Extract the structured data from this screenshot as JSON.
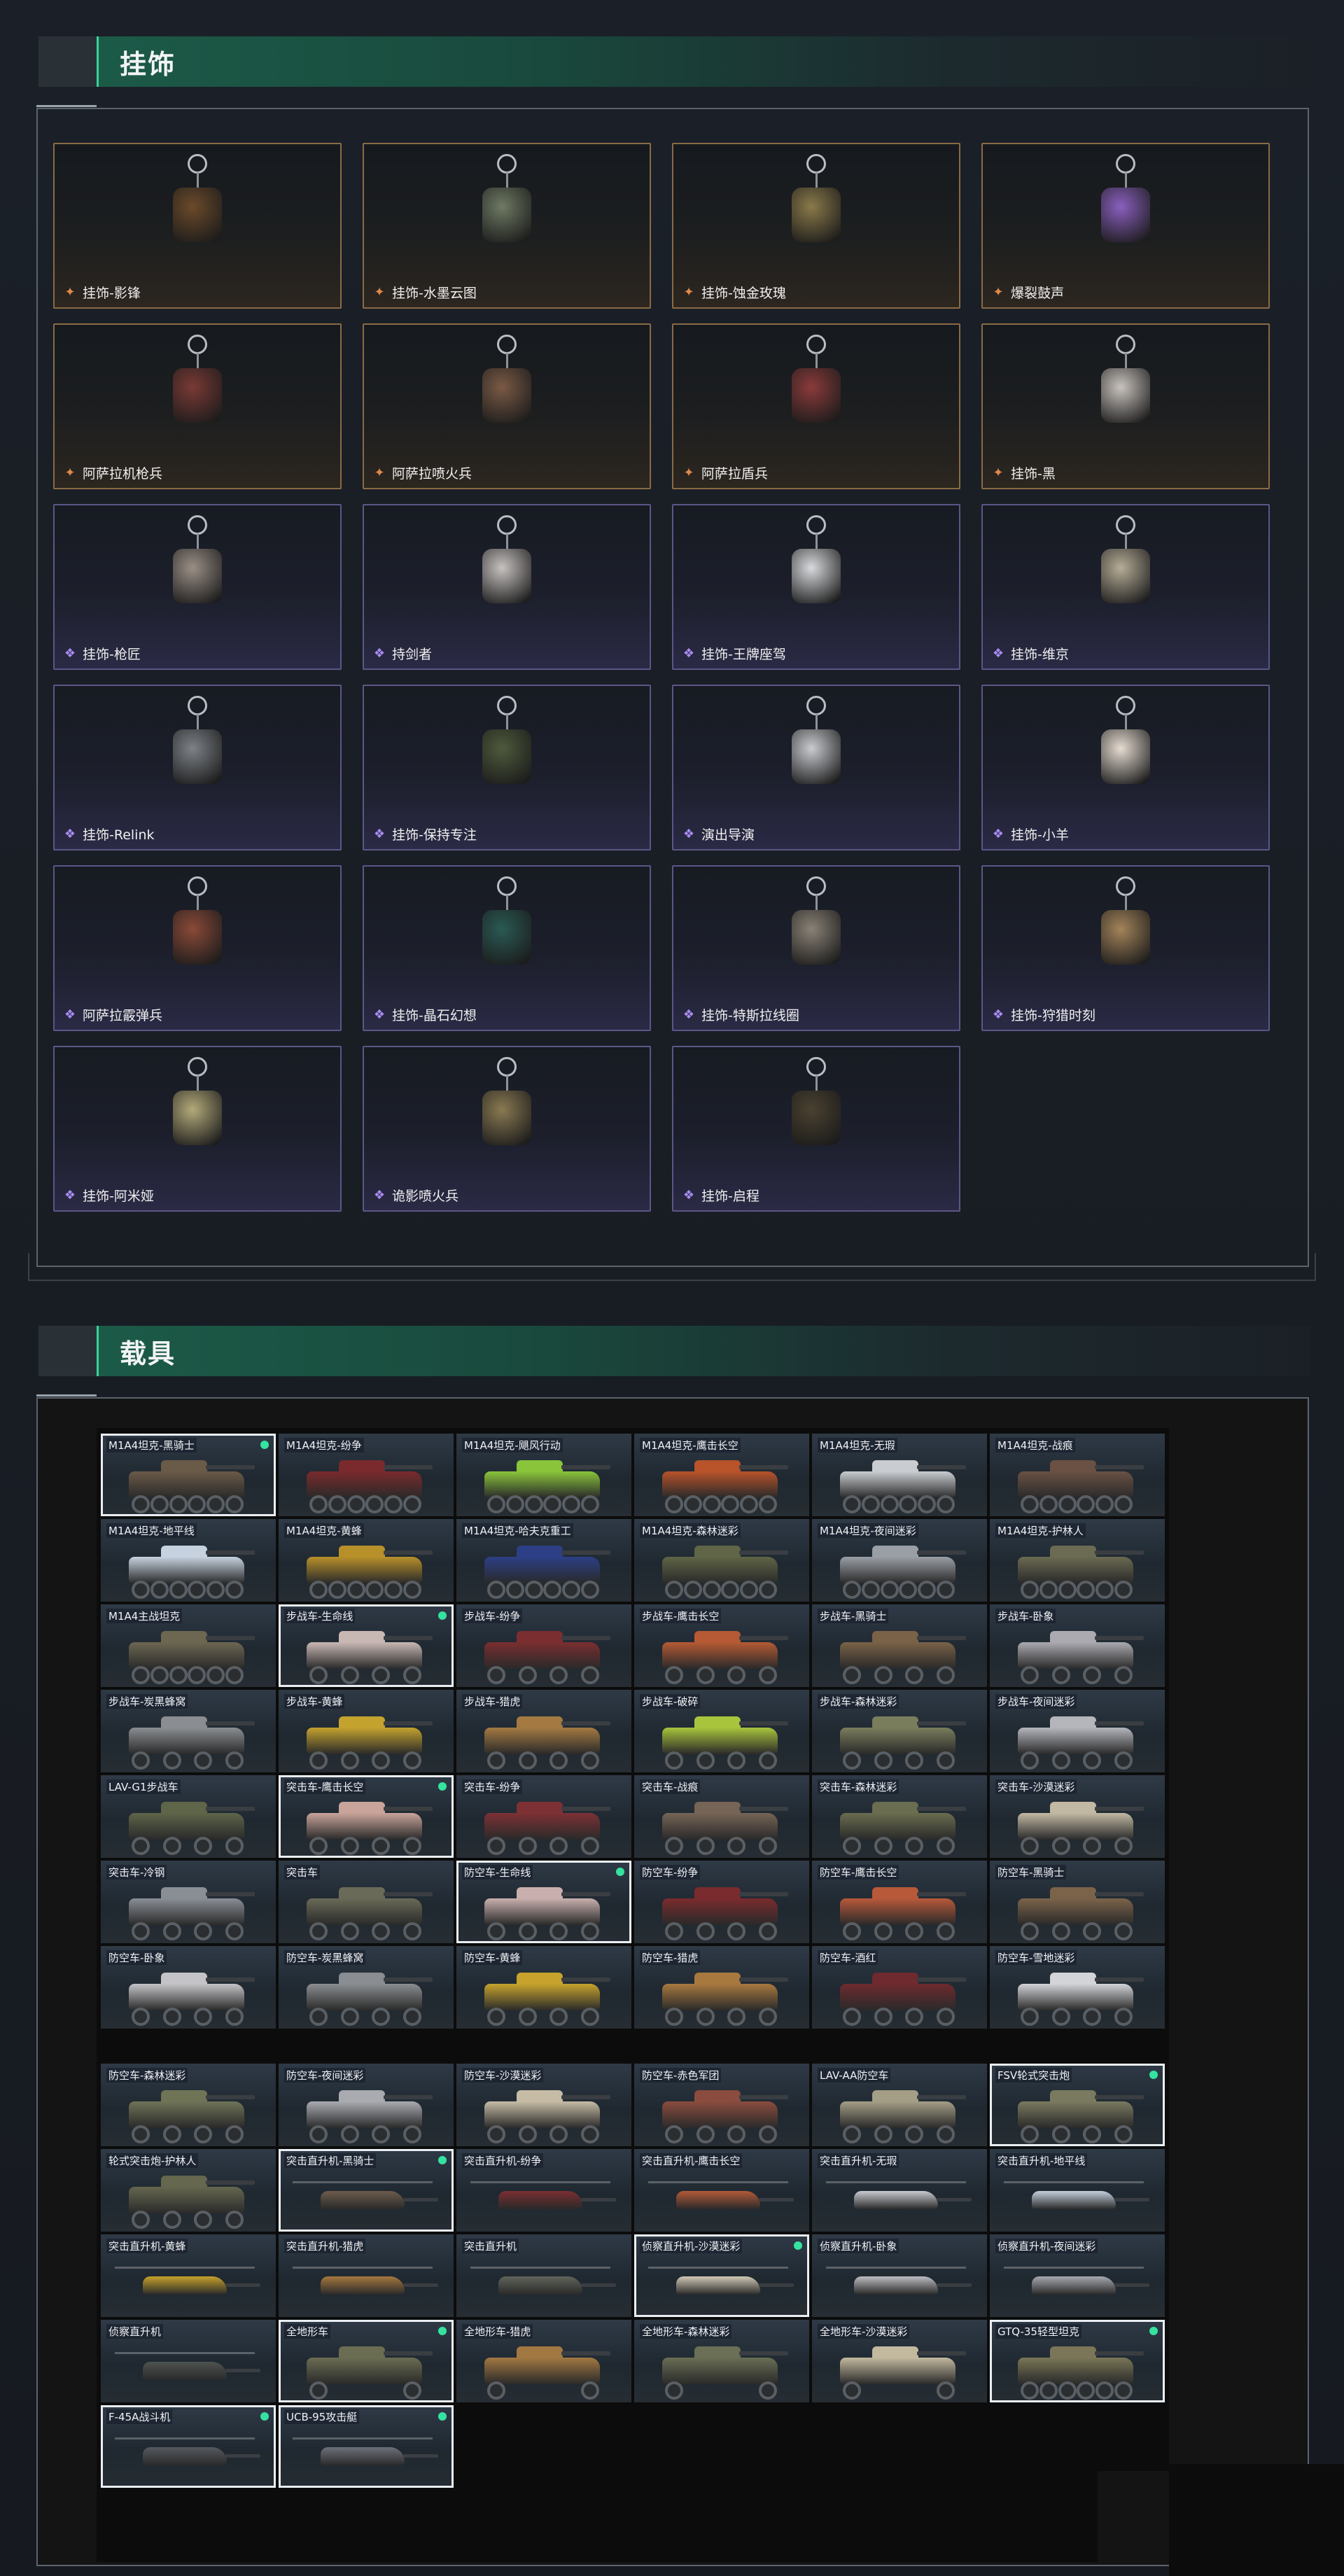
{
  "sections": {
    "charms": {
      "title": "挂饰"
    },
    "vehicles": {
      "title": "载具"
    }
  },
  "charms": [
    {
      "name": "挂饰-影锋",
      "quality": "gold",
      "color": "#6b4a2a"
    },
    {
      "name": "挂饰-水墨云图",
      "quality": "gold",
      "color": "#6e7a63"
    },
    {
      "name": "挂饰-蚀金玫瑰",
      "quality": "gold",
      "color": "#8a7a4a"
    },
    {
      "name": "爆裂鼓声",
      "quality": "gold",
      "color": "#8a5fbf"
    },
    {
      "name": "阿萨拉机枪兵",
      "quality": "gold",
      "color": "#7a3a35"
    },
    {
      "name": "阿萨拉喷火兵",
      "quality": "gold",
      "color": "#7a5a45"
    },
    {
      "name": "阿萨拉盾兵",
      "quality": "gold",
      "color": "#8a3a3a"
    },
    {
      "name": "挂饰-黑",
      "quality": "gold",
      "color": "#c9c3bd"
    },
    {
      "name": "挂饰-枪匠",
      "quality": "purple",
      "color": "#9a8f86"
    },
    {
      "name": "持剑者",
      "quality": "purple",
      "color": "#c7c2c0"
    },
    {
      "name": "挂饰-王牌座驾",
      "quality": "purple",
      "color": "#d8dadd"
    },
    {
      "name": "挂饰-维京",
      "quality": "purple",
      "color": "#b6ad97"
    },
    {
      "name": "挂饰-Relink",
      "quality": "purple",
      "color": "#7d8288"
    },
    {
      "name": "挂饰-保持专注",
      "quality": "purple",
      "color": "#4e5a3c"
    },
    {
      "name": "演出导演",
      "quality": "purple",
      "color": "#c9cbd0"
    },
    {
      "name": "挂饰-小羊",
      "quality": "purple",
      "color": "#e6dcd1"
    },
    {
      "name": "阿萨拉霰弹兵",
      "quality": "purple",
      "color": "#8a4a38"
    },
    {
      "name": "挂饰-晶石幻想",
      "quality": "purple",
      "color": "#2a5a54"
    },
    {
      "name": "挂饰-特斯拉线圈",
      "quality": "purple",
      "color": "#8a8276"
    },
    {
      "name": "挂饰-狩猎时刻",
      "quality": "purple",
      "color": "#a4845a"
    },
    {
      "name": "挂饰-阿米娅",
      "quality": "purple",
      "color": "#b3aa7a"
    },
    {
      "name": "诡影喷火兵",
      "quality": "purple",
      "color": "#8a7a52"
    },
    {
      "name": "挂饰-启程",
      "quality": "purple",
      "color": "#4a4130"
    }
  ],
  "vehicles_group1": [
    {
      "name": "M1A4坦克-黑骑士",
      "type": "tank",
      "color": "#6a5a48",
      "selected": true,
      "owned": true
    },
    {
      "name": "M1A4坦克-纷争",
      "type": "tank",
      "color": "#7a2a2c",
      "selected": false,
      "owned": false
    },
    {
      "name": "M1A4坦克-飓风行动",
      "type": "tank",
      "color": "#8ac43a",
      "selected": false,
      "owned": false
    },
    {
      "name": "M1A4坦克-鹰击长空",
      "type": "tank",
      "color": "#b8532a",
      "selected": false,
      "owned": false
    },
    {
      "name": "M1A4坦克-无瑕",
      "type": "tank",
      "color": "#c9cdd1",
      "selected": false,
      "owned": false
    },
    {
      "name": "M1A4坦克-战痕",
      "type": "tank",
      "color": "#6a5144",
      "selected": false,
      "owned": false
    },
    {
      "name": "M1A4坦克-地平线",
      "type": "tank",
      "color": "#c7d2e0",
      "selected": false,
      "owned": false
    },
    {
      "name": "M1A4坦克-黄蜂",
      "type": "tank",
      "color": "#b8902a",
      "selected": false,
      "owned": false
    },
    {
      "name": "M1A4坦克-哈夫克重工",
      "type": "tank",
      "color": "#2c3f86",
      "selected": false,
      "owned": false
    },
    {
      "name": "M1A4坦克-森林迷彩",
      "type": "tank",
      "color": "#5f6546",
      "selected": false,
      "owned": false
    },
    {
      "name": "M1A4坦克-夜间迷彩",
      "type": "tank",
      "color": "#9a9ea5",
      "selected": false,
      "owned": false
    },
    {
      "name": "M1A4坦克-护林人",
      "type": "tank",
      "color": "#6b6a52",
      "selected": false,
      "owned": false
    },
    {
      "name": "M1A4主战坦克",
      "type": "tank",
      "color": "#6d6752",
      "selected": false,
      "owned": false
    },
    {
      "name": "步战车-生命线",
      "type": "ifv",
      "color": "#c8b8b4",
      "selected": true,
      "owned": true
    },
    {
      "name": "步战车-纷争",
      "type": "ifv",
      "color": "#7a2e30",
      "selected": false,
      "owned": false
    },
    {
      "name": "步战车-鹰击长空",
      "type": "ifv",
      "color": "#b55a34",
      "selected": false,
      "owned": false
    },
    {
      "name": "步战车-黑骑士",
      "type": "ifv",
      "color": "#7a6248",
      "selected": false,
      "owned": false
    },
    {
      "name": "步战车-卧象",
      "type": "ifv",
      "color": "#aaaab0",
      "selected": false,
      "owned": false
    },
    {
      "name": "步战车-炭黑蜂窝",
      "type": "ifv",
      "color": "#8a8e92",
      "selected": false,
      "owned": false
    },
    {
      "name": "步战车-黄蜂",
      "type": "ifv",
      "color": "#c4a22e",
      "selected": false,
      "owned": false
    },
    {
      "name": "步战车-猎虎",
      "type": "ifv",
      "color": "#a47a42",
      "selected": false,
      "owned": false
    },
    {
      "name": "步战车-破碎",
      "type": "ifv",
      "color": "#a8c43c",
      "selected": false,
      "owned": false
    },
    {
      "name": "步战车-森林迷彩",
      "type": "ifv",
      "color": "#7a7d5c",
      "selected": false,
      "owned": false
    },
    {
      "name": "步战车-夜间迷彩",
      "type": "ifv",
      "color": "#b4b6bc",
      "selected": false,
      "owned": false
    },
    {
      "name": "LAV-G1步战车",
      "type": "ifv",
      "color": "#5e6549",
      "selected": false,
      "owned": false
    },
    {
      "name": "突击车-鹰击长空",
      "type": "car",
      "color": "#c9a49a",
      "selected": true,
      "owned": true
    },
    {
      "name": "突击车-纷争",
      "type": "car",
      "color": "#7d3135",
      "selected": false,
      "owned": false
    },
    {
      "name": "突击车-战痕",
      "type": "car",
      "color": "#766456",
      "selected": false,
      "owned": false
    },
    {
      "name": "突击车-森林迷彩",
      "type": "car",
      "color": "#6a6d4f",
      "selected": false,
      "owned": false
    },
    {
      "name": "突击车-沙漠迷彩",
      "type": "car",
      "color": "#c2b9a4",
      "selected": false,
      "owned": false
    },
    {
      "name": "突击车-冷钢",
      "type": "car",
      "color": "#8a8f96",
      "selected": false,
      "owned": false
    },
    {
      "name": "突击车",
      "type": "car",
      "color": "#6a6a58",
      "selected": false,
      "owned": false
    },
    {
      "name": "防空车-生命线",
      "type": "ifv",
      "color": "#c9b0ae",
      "selected": true,
      "owned": true
    },
    {
      "name": "防空车-纷争",
      "type": "ifv",
      "color": "#7a2b2d",
      "selected": false,
      "owned": false
    },
    {
      "name": "防空车-鹰击长空",
      "type": "ifv",
      "color": "#b8593a",
      "selected": false,
      "owned": false
    },
    {
      "name": "防空车-黑骑士",
      "type": "ifv",
      "color": "#7b634a",
      "selected": false,
      "owned": false
    },
    {
      "name": "防空车-卧象",
      "type": "ifv",
      "color": "#c4c4c8",
      "selected": false,
      "owned": false
    },
    {
      "name": "防空车-炭黑蜂窝",
      "type": "ifv",
      "color": "#8a8d91",
      "selected": false,
      "owned": false
    },
    {
      "name": "防空车-黄蜂",
      "type": "ifv",
      "color": "#c7a32d",
      "selected": false,
      "owned": false
    },
    {
      "name": "防空车-猎虎",
      "type": "ifv",
      "color": "#a8793f",
      "selected": false,
      "owned": false
    },
    {
      "name": "防空车-酒红",
      "type": "ifv",
      "color": "#6e2a2e",
      "selected": false,
      "owned": false
    },
    {
      "name": "防空车-雪地迷彩",
      "type": "ifv",
      "color": "#d2d4d8",
      "selected": false,
      "owned": false
    }
  ],
  "vehicles_group2": [
    {
      "name": "防空车-森林迷彩",
      "type": "ifv",
      "color": "#6f7457",
      "selected": false,
      "owned": false
    },
    {
      "name": "防空车-夜间迷彩",
      "type": "ifv",
      "color": "#a9abb1",
      "selected": false,
      "owned": false
    },
    {
      "name": "防空车-沙漠迷彩",
      "type": "ifv",
      "color": "#c6bca6",
      "selected": false,
      "owned": false
    },
    {
      "name": "防空车-赤色军团",
      "type": "ifv",
      "color": "#8a4c3e",
      "selected": false,
      "owned": false
    },
    {
      "name": "LAV-AA防空车",
      "type": "ifv",
      "color": "#a59e87",
      "selected": false,
      "owned": false
    },
    {
      "name": "FSV轮式突击炮",
      "type": "car",
      "color": "#7a7a60",
      "selected": true,
      "owned": true
    },
    {
      "name": "轮式突击炮-护林人",
      "type": "car",
      "color": "#65674f",
      "selected": false,
      "owned": false
    },
    {
      "name": "突击直升机-黑骑士",
      "type": "heli",
      "color": "#6c5c4c",
      "selected": true,
      "owned": true
    },
    {
      "name": "突击直升机-纷争",
      "type": "heli",
      "color": "#7a2e31",
      "selected": false,
      "owned": false
    },
    {
      "name": "突击直升机-鹰击长空",
      "type": "heli",
      "color": "#b35a39",
      "selected": false,
      "owned": false
    },
    {
      "name": "突击直升机-无瑕",
      "type": "heli",
      "color": "#c8cbd0",
      "selected": false,
      "owned": false
    },
    {
      "name": "突击直升机-地平线",
      "type": "heli",
      "color": "#c4cfdd",
      "selected": false,
      "owned": false
    },
    {
      "name": "突击直升机-黄蜂",
      "type": "heli",
      "color": "#c6a12c",
      "selected": false,
      "owned": false
    },
    {
      "name": "突击直升机-猎虎",
      "type": "heli",
      "color": "#a5773f",
      "selected": false,
      "owned": false
    },
    {
      "name": "突击直升机",
      "type": "heli",
      "color": "#5f645a",
      "selected": false,
      "owned": false
    },
    {
      "name": "侦察直升机-沙漠迷彩",
      "type": "heli",
      "color": "#d0c8b5",
      "selected": true,
      "owned": true
    },
    {
      "name": "侦察直升机-卧象",
      "type": "heli",
      "color": "#bcbcc2",
      "selected": false,
      "owned": false
    },
    {
      "name": "侦察直升机-夜间迷彩",
      "type": "heli",
      "color": "#a6a9af",
      "selected": false,
      "owned": false
    },
    {
      "name": "侦察直升机",
      "type": "heli",
      "color": "#4e5350",
      "selected": false,
      "owned": false
    },
    {
      "name": "全地形车",
      "type": "atv",
      "color": "#6b6d53",
      "selected": true,
      "owned": true
    },
    {
      "name": "全地形车-猎虎",
      "type": "atv",
      "color": "#a27842",
      "selected": false,
      "owned": false
    },
    {
      "name": "全地形车-森林迷彩",
      "type": "atv",
      "color": "#6a6f55",
      "selected": false,
      "owned": false
    },
    {
      "name": "全地形车-沙漠迷彩",
      "type": "atv",
      "color": "#c3b99f",
      "selected": false,
      "owned": false
    },
    {
      "name": "GTQ-35轻型坦克",
      "type": "tank",
      "color": "#7a7657",
      "selected": true,
      "owned": true
    },
    {
      "name": "F-45A战斗机",
      "type": "heli",
      "color": "#55595e",
      "selected": true,
      "owned": true
    },
    {
      "name": "UCB-95攻击艇",
      "type": "heli",
      "color": "#6c7179",
      "selected": true,
      "owned": true
    }
  ]
}
